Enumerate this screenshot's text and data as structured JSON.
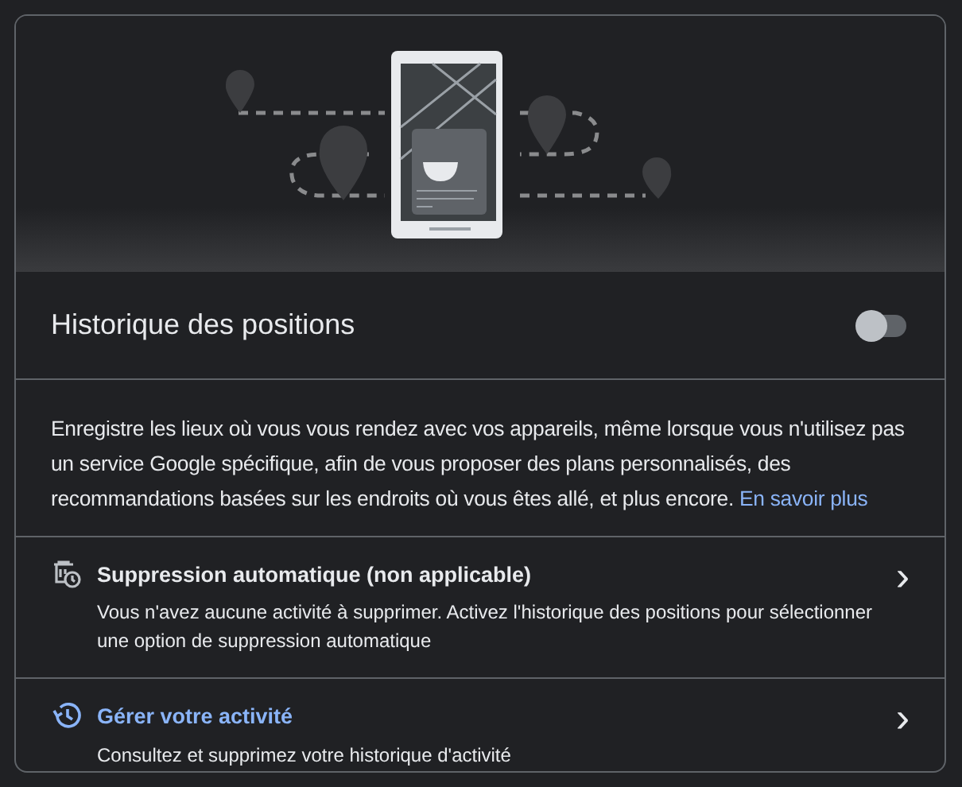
{
  "setting": {
    "title": "Historique des positions",
    "toggle": {
      "on": false
    }
  },
  "description": {
    "text": "Enregistre les lieux où vous vous rendez avec vos appareils, même lorsque vous n'utilisez pas un service Google spécifique, afin de vous proposer des plans personnalisés, des recommandations basées sur les endroits où vous êtes allé, et plus encore.",
    "link": "En savoir plus"
  },
  "actions": [
    {
      "kind": "auto_delete",
      "title": "Suppression automatique (non applicable)",
      "subtitle": "Vous n'avez aucune activité à supprimer. Activez l'historique des positions pour sélectionner une option de suppression automatique",
      "chevron": "›"
    },
    {
      "kind": "activity",
      "title": "Gérer votre activité",
      "subtitle": "Consultez et supprimez votre historique d'activité",
      "chevron": "›"
    }
  ]
}
